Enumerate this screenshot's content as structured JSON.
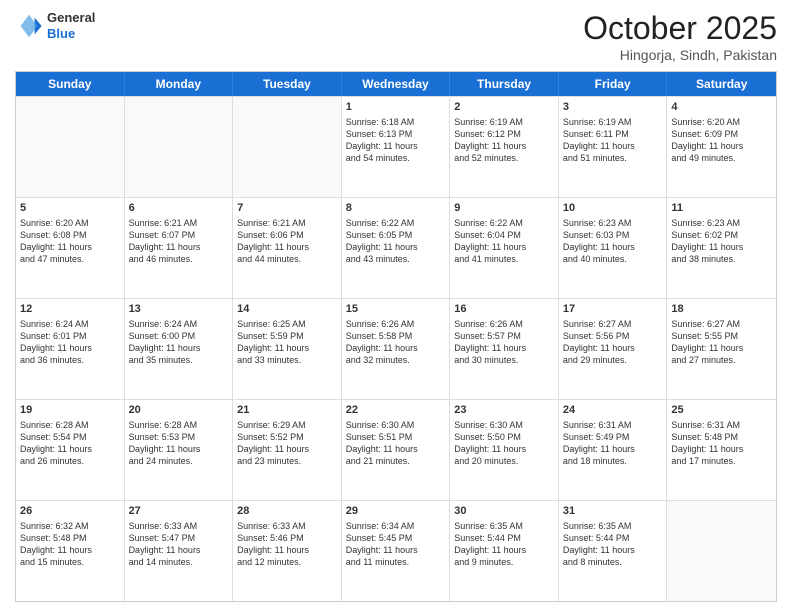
{
  "header": {
    "logo_line1": "General",
    "logo_line2": "Blue",
    "month": "October 2025",
    "location": "Hingorja, Sindh, Pakistan"
  },
  "weekdays": [
    "Sunday",
    "Monday",
    "Tuesday",
    "Wednesday",
    "Thursday",
    "Friday",
    "Saturday"
  ],
  "rows": [
    [
      {
        "day": "",
        "info": ""
      },
      {
        "day": "",
        "info": ""
      },
      {
        "day": "",
        "info": ""
      },
      {
        "day": "1",
        "info": "Sunrise: 6:18 AM\nSunset: 6:13 PM\nDaylight: 11 hours\nand 54 minutes."
      },
      {
        "day": "2",
        "info": "Sunrise: 6:19 AM\nSunset: 6:12 PM\nDaylight: 11 hours\nand 52 minutes."
      },
      {
        "day": "3",
        "info": "Sunrise: 6:19 AM\nSunset: 6:11 PM\nDaylight: 11 hours\nand 51 minutes."
      },
      {
        "day": "4",
        "info": "Sunrise: 6:20 AM\nSunset: 6:09 PM\nDaylight: 11 hours\nand 49 minutes."
      }
    ],
    [
      {
        "day": "5",
        "info": "Sunrise: 6:20 AM\nSunset: 6:08 PM\nDaylight: 11 hours\nand 47 minutes."
      },
      {
        "day": "6",
        "info": "Sunrise: 6:21 AM\nSunset: 6:07 PM\nDaylight: 11 hours\nand 46 minutes."
      },
      {
        "day": "7",
        "info": "Sunrise: 6:21 AM\nSunset: 6:06 PM\nDaylight: 11 hours\nand 44 minutes."
      },
      {
        "day": "8",
        "info": "Sunrise: 6:22 AM\nSunset: 6:05 PM\nDaylight: 11 hours\nand 43 minutes."
      },
      {
        "day": "9",
        "info": "Sunrise: 6:22 AM\nSunset: 6:04 PM\nDaylight: 11 hours\nand 41 minutes."
      },
      {
        "day": "10",
        "info": "Sunrise: 6:23 AM\nSunset: 6:03 PM\nDaylight: 11 hours\nand 40 minutes."
      },
      {
        "day": "11",
        "info": "Sunrise: 6:23 AM\nSunset: 6:02 PM\nDaylight: 11 hours\nand 38 minutes."
      }
    ],
    [
      {
        "day": "12",
        "info": "Sunrise: 6:24 AM\nSunset: 6:01 PM\nDaylight: 11 hours\nand 36 minutes."
      },
      {
        "day": "13",
        "info": "Sunrise: 6:24 AM\nSunset: 6:00 PM\nDaylight: 11 hours\nand 35 minutes."
      },
      {
        "day": "14",
        "info": "Sunrise: 6:25 AM\nSunset: 5:59 PM\nDaylight: 11 hours\nand 33 minutes."
      },
      {
        "day": "15",
        "info": "Sunrise: 6:26 AM\nSunset: 5:58 PM\nDaylight: 11 hours\nand 32 minutes."
      },
      {
        "day": "16",
        "info": "Sunrise: 6:26 AM\nSunset: 5:57 PM\nDaylight: 11 hours\nand 30 minutes."
      },
      {
        "day": "17",
        "info": "Sunrise: 6:27 AM\nSunset: 5:56 PM\nDaylight: 11 hours\nand 29 minutes."
      },
      {
        "day": "18",
        "info": "Sunrise: 6:27 AM\nSunset: 5:55 PM\nDaylight: 11 hours\nand 27 minutes."
      }
    ],
    [
      {
        "day": "19",
        "info": "Sunrise: 6:28 AM\nSunset: 5:54 PM\nDaylight: 11 hours\nand 26 minutes."
      },
      {
        "day": "20",
        "info": "Sunrise: 6:28 AM\nSunset: 5:53 PM\nDaylight: 11 hours\nand 24 minutes."
      },
      {
        "day": "21",
        "info": "Sunrise: 6:29 AM\nSunset: 5:52 PM\nDaylight: 11 hours\nand 23 minutes."
      },
      {
        "day": "22",
        "info": "Sunrise: 6:30 AM\nSunset: 5:51 PM\nDaylight: 11 hours\nand 21 minutes."
      },
      {
        "day": "23",
        "info": "Sunrise: 6:30 AM\nSunset: 5:50 PM\nDaylight: 11 hours\nand 20 minutes."
      },
      {
        "day": "24",
        "info": "Sunrise: 6:31 AM\nSunset: 5:49 PM\nDaylight: 11 hours\nand 18 minutes."
      },
      {
        "day": "25",
        "info": "Sunrise: 6:31 AM\nSunset: 5:48 PM\nDaylight: 11 hours\nand 17 minutes."
      }
    ],
    [
      {
        "day": "26",
        "info": "Sunrise: 6:32 AM\nSunset: 5:48 PM\nDaylight: 11 hours\nand 15 minutes."
      },
      {
        "day": "27",
        "info": "Sunrise: 6:33 AM\nSunset: 5:47 PM\nDaylight: 11 hours\nand 14 minutes."
      },
      {
        "day": "28",
        "info": "Sunrise: 6:33 AM\nSunset: 5:46 PM\nDaylight: 11 hours\nand 12 minutes."
      },
      {
        "day": "29",
        "info": "Sunrise: 6:34 AM\nSunset: 5:45 PM\nDaylight: 11 hours\nand 11 minutes."
      },
      {
        "day": "30",
        "info": "Sunrise: 6:35 AM\nSunset: 5:44 PM\nDaylight: 11 hours\nand 9 minutes."
      },
      {
        "day": "31",
        "info": "Sunrise: 6:35 AM\nSunset: 5:44 PM\nDaylight: 11 hours\nand 8 minutes."
      },
      {
        "day": "",
        "info": ""
      }
    ]
  ]
}
